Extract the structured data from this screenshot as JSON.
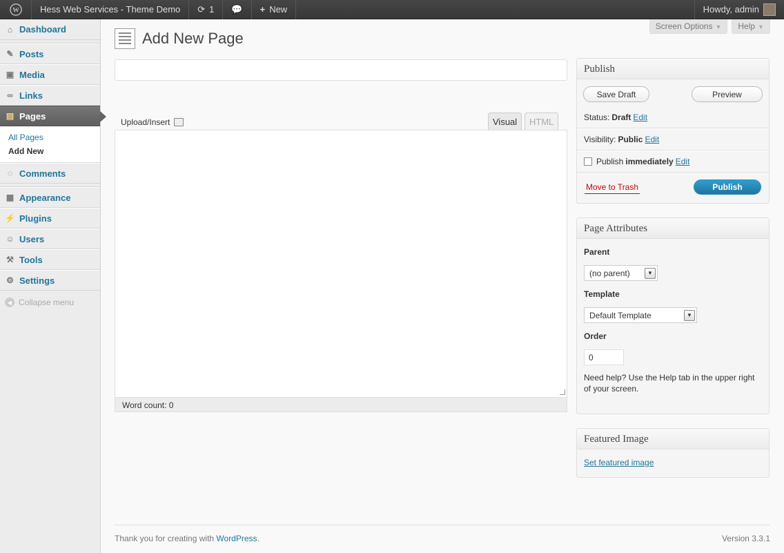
{
  "adminbar": {
    "site": "Hess Web Services - Theme Demo",
    "updates": "1",
    "new": "New",
    "howdy": "Howdy, admin"
  },
  "sidebar": {
    "items": [
      {
        "label": "Dashboard"
      },
      {
        "label": "Posts"
      },
      {
        "label": "Media"
      },
      {
        "label": "Links"
      },
      {
        "label": "Pages"
      },
      {
        "label": "Comments"
      },
      {
        "label": "Appearance"
      },
      {
        "label": "Plugins"
      },
      {
        "label": "Users"
      },
      {
        "label": "Tools"
      },
      {
        "label": "Settings"
      }
    ],
    "submenu": [
      "All Pages",
      "Add New"
    ],
    "collapse": "Collapse menu"
  },
  "screen_options": "Screen Options",
  "help_tab": "Help",
  "page_title": "Add New Page",
  "editor": {
    "upload": "Upload/Insert",
    "visual": "Visual",
    "html": "HTML",
    "word_count": "Word count: 0"
  },
  "publish": {
    "title": "Publish",
    "save_draft": "Save Draft",
    "preview": "Preview",
    "status_label": "Status:",
    "status_value": "Draft",
    "visibility_label": "Visibility:",
    "visibility_value": "Public",
    "publish_label": "Publish",
    "publish_value": "immediately",
    "edit": "Edit",
    "trash": "Move to Trash",
    "publish_btn": "Publish"
  },
  "attributes": {
    "title": "Page Attributes",
    "parent_label": "Parent",
    "parent_value": "(no parent)",
    "template_label": "Template",
    "template_value": "Default Template",
    "order_label": "Order",
    "order_value": "0",
    "help": "Need help? Use the Help tab in the upper right of your screen."
  },
  "featured": {
    "title": "Featured Image",
    "link": "Set featured image"
  },
  "footer": {
    "thanks": "Thank you for creating with ",
    "wp": "WordPress",
    "dot": ".",
    "version": "Version 3.3.1"
  }
}
